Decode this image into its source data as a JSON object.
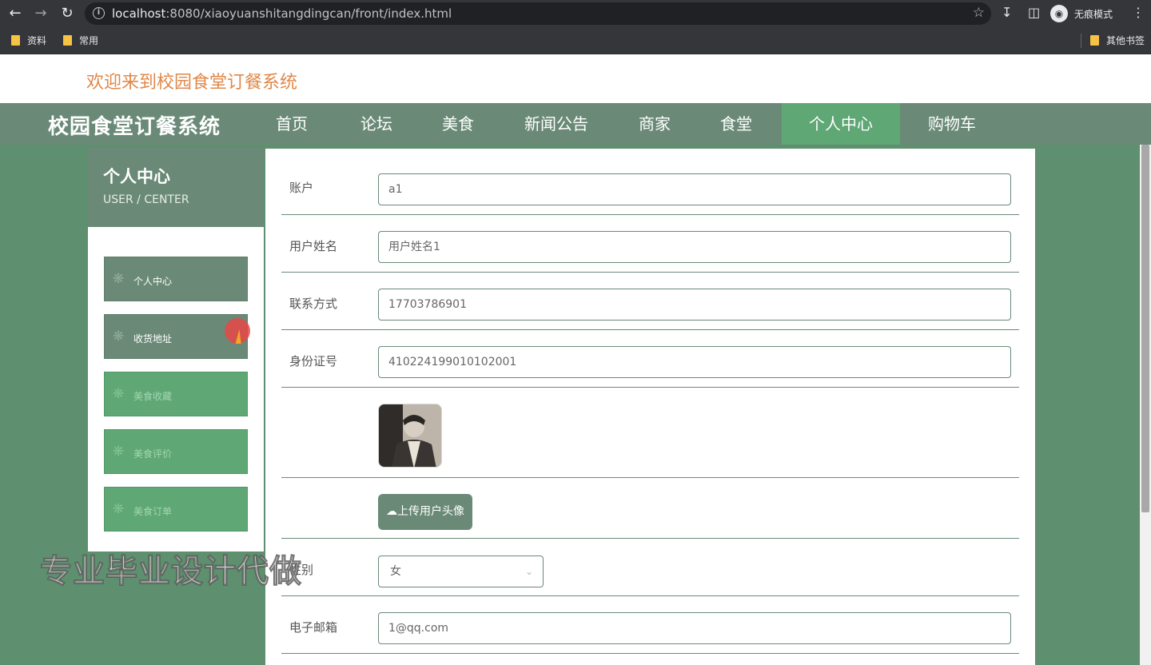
{
  "browser": {
    "url_host": "localhost",
    "url_rest": ":8080/xiaoyuanshitangdingcan/front/index.html",
    "incognito_label": "无痕模式",
    "bookmarks": [
      "资料",
      "常用"
    ],
    "other_bookmarks": "其他书签"
  },
  "header": {
    "welcome": "欢迎来到校园食堂订餐系统"
  },
  "nav": {
    "brand": "校园食堂订餐系统",
    "items": [
      "首页",
      "论坛",
      "美食",
      "新闻公告",
      "商家",
      "食堂",
      "个人中心",
      "购物车"
    ],
    "active": "个人中心"
  },
  "sidebar": {
    "title": "个人中心",
    "subtitle": "USER / CENTER",
    "items": [
      {
        "label": "个人中心",
        "icon": "asterisk-icon"
      },
      {
        "label": "收货地址",
        "icon": "asterisk-icon"
      },
      {
        "label": "美食收藏",
        "icon": "asterisk-icon"
      },
      {
        "label": "美食评价",
        "icon": "asterisk-icon"
      },
      {
        "label": "美食订单",
        "icon": "asterisk-icon"
      }
    ]
  },
  "form": {
    "account_label": "账户",
    "account_value": "a1",
    "name_label": "用户姓名",
    "name_value": "用户姓名1",
    "phone_label": "联系方式",
    "phone_value": "17703786901",
    "id_label": "身份证号",
    "id_value": "410224199010102001",
    "upload_label": "上传用户头像",
    "gender_label": "性别",
    "gender_value": "女",
    "email_label": "电子邮箱",
    "email_value": "1@qq.com"
  },
  "overlay": {
    "watermark": "专业毕业设计代做"
  },
  "colors": {
    "nav_bg": "#6a8a77",
    "active_green": "#5fa774",
    "welcome_orange": "#e0884a"
  }
}
